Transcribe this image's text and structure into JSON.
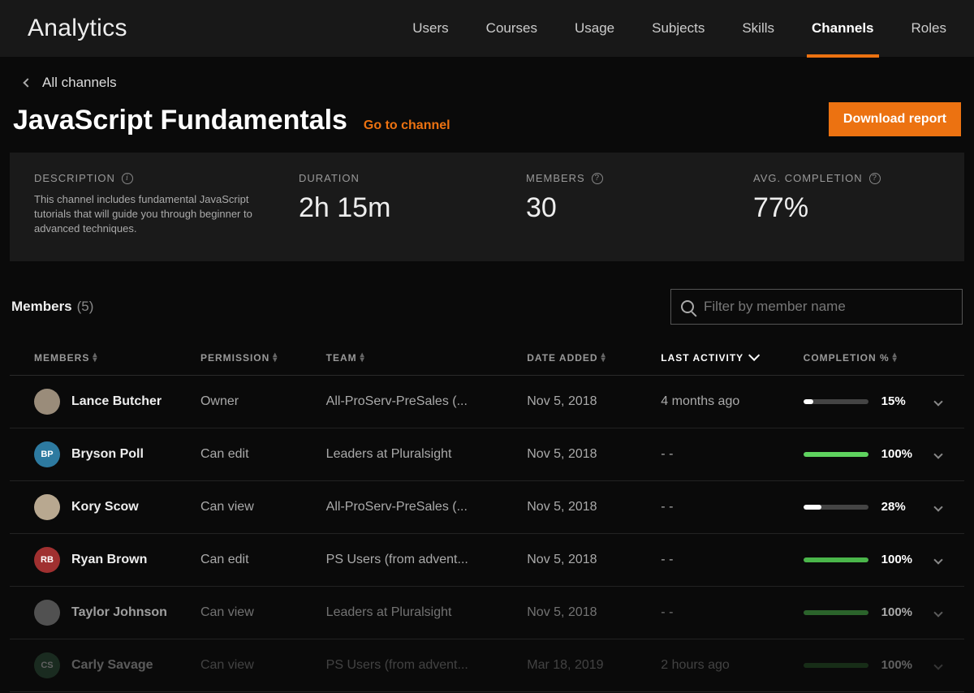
{
  "header": {
    "brand": "Analytics",
    "nav": [
      "Users",
      "Courses",
      "Usage",
      "Subjects",
      "Skills",
      "Channels",
      "Roles"
    ],
    "active_nav": "Channels"
  },
  "breadcrumb": {
    "back_label": "All channels"
  },
  "title_row": {
    "title": "JavaScript Fundamentals",
    "goto_label": "Go to channel",
    "download_label": "Download report"
  },
  "summary": {
    "description_label": "DESCRIPTION",
    "description_text": "This channel includes fundamental JavaScript tutorials that will guide you through beginner to advanced techniques.",
    "duration_label": "DURATION",
    "duration_value": "2h 15m",
    "members_label": "MEMBERS",
    "members_value": "30",
    "avg_label": "AVG. COMPLETION",
    "avg_value": "77%"
  },
  "members_section": {
    "title": "Members",
    "count": "(5)",
    "search_placeholder": "Filter by member name"
  },
  "columns": {
    "members": "MEMBERS",
    "permission": "PERMISSION",
    "team": "TEAM",
    "date_added": "DATE ADDED",
    "last_activity": "LAST ACTIVITY",
    "completion": "COMPLETION %"
  },
  "rows": [
    {
      "name": "Lance Butcher",
      "avatar_initials": "",
      "avatar_bg": "#9a8c7a",
      "permission": "Owner",
      "team": "All-ProServ-PreSales (...",
      "date_added": "Nov 5, 2018",
      "last_activity": "4 months ago",
      "completion_pct": "15%",
      "completion_val": 15,
      "bar_color": "#ffffff"
    },
    {
      "name": "Bryson Poll",
      "avatar_initials": "BP",
      "avatar_bg": "#2d7aa0",
      "permission": "Can edit",
      "team": "Leaders at Pluralsight",
      "date_added": "Nov 5, 2018",
      "last_activity": "- -",
      "completion_pct": "100%",
      "completion_val": 100,
      "bar_color": "#5fd35f"
    },
    {
      "name": "Kory Scow",
      "avatar_initials": "",
      "avatar_bg": "#b8a890",
      "permission": "Can view",
      "team": "All-ProServ-PreSales (...",
      "date_added": "Nov 5, 2018",
      "last_activity": "- -",
      "completion_pct": "28%",
      "completion_val": 28,
      "bar_color": "#ffffff"
    },
    {
      "name": "Ryan Brown",
      "avatar_initials": "RB",
      "avatar_bg": "#a03030",
      "permission": "Can edit",
      "team": "PS Users (from advent...",
      "date_added": "Nov 5, 2018",
      "last_activity": "- -",
      "completion_pct": "100%",
      "completion_val": 100,
      "bar_color": "#4ab64a"
    },
    {
      "name": "Taylor Johnson",
      "avatar_initials": "",
      "avatar_bg": "#777",
      "permission": "Can view",
      "team": "Leaders at Pluralsight",
      "date_added": "Nov 5, 2018",
      "last_activity": "- -",
      "completion_pct": "100%",
      "completion_val": 100,
      "bar_color": "#3d933d"
    },
    {
      "name": "Carly Savage",
      "avatar_initials": "CS",
      "avatar_bg": "#3a6a4a",
      "permission": "Can view",
      "team": "PS Users (from advent...",
      "date_added": "Mar 18, 2019",
      "last_activity": "2 hours ago",
      "completion_pct": "100%",
      "completion_val": 100,
      "bar_color": "#2f6f2f"
    }
  ]
}
